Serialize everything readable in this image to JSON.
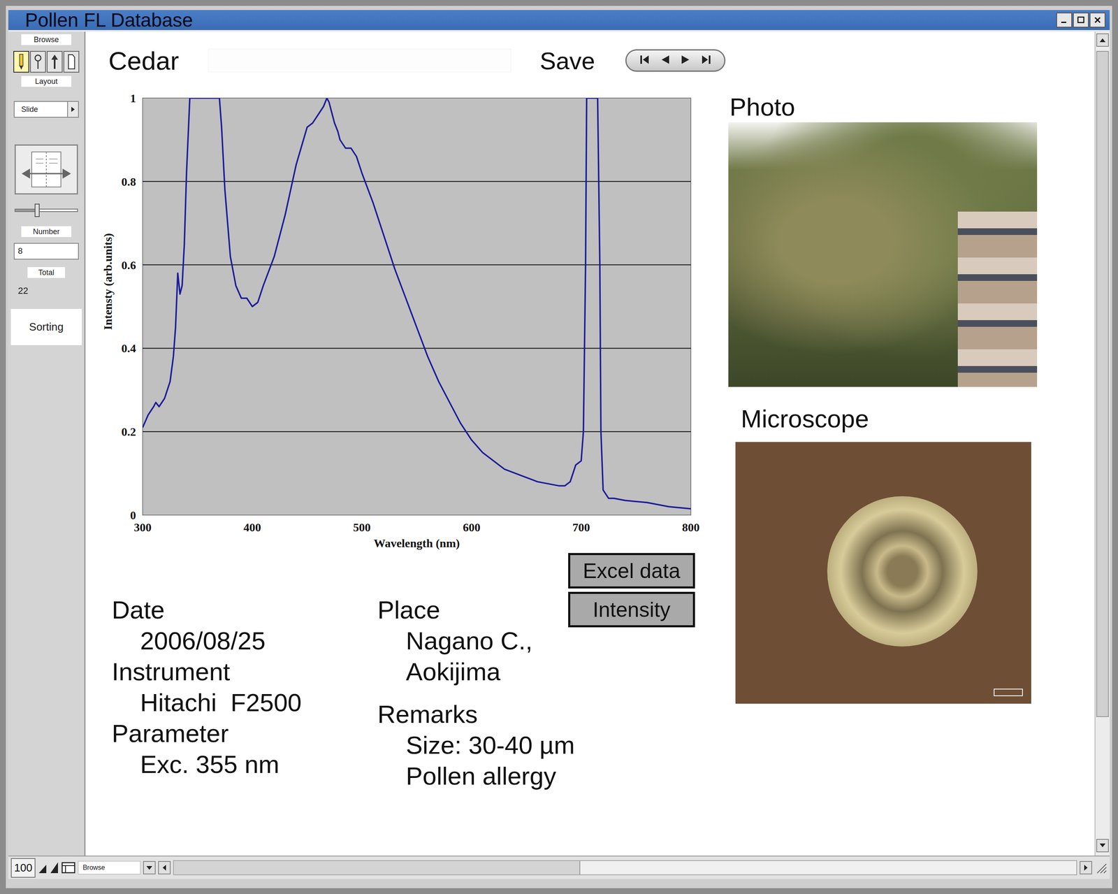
{
  "window": {
    "title": "Pollen FL Database"
  },
  "toolbar": {
    "mode_label": "Browse",
    "tools": [
      {
        "selected": true
      },
      {
        "selected": false
      },
      {
        "selected": false
      },
      {
        "selected": false
      }
    ],
    "layout_label": "Layout",
    "layout_value": "Slide",
    "slider": {
      "level": 0.35
    },
    "record_label": "Number",
    "record_value": "8",
    "total_label": "Total",
    "total_value": "22",
    "sorting": "Sorting"
  },
  "record": {
    "title": "Cedar",
    "save": "Save"
  },
  "chart": {
    "y_title": "Intensty (arb.units)",
    "x_title": "Wavelength (nm)",
    "x_ticks": [
      "300",
      "400",
      "500",
      "600",
      "700",
      "800"
    ],
    "y_ticks": [
      "0",
      "0.2",
      "0.4",
      "0.6",
      "0.8",
      "1"
    ],
    "series": [
      {
        "x": [
          300,
          305,
          310,
          312,
          315,
          320,
          325,
          328,
          330,
          332,
          334,
          336,
          338,
          340,
          343,
          346,
          350,
          360,
          368,
          370,
          372,
          375,
          380,
          385,
          390,
          395,
          400,
          405,
          410,
          420,
          430,
          440,
          450,
          455,
          460,
          465,
          468,
          470,
          472,
          475,
          478,
          480,
          485,
          490,
          495,
          500,
          510,
          520,
          530,
          540,
          550,
          560,
          570,
          580,
          590,
          600,
          610,
          620,
          630,
          640,
          650,
          660,
          670,
          680,
          685,
          690,
          695,
          700,
          702,
          704,
          705,
          710,
          715,
          717,
          718,
          720,
          725,
          730,
          740,
          760,
          780,
          800
        ],
        "y": [
          0.21,
          0.24,
          0.26,
          0.27,
          0.26,
          0.28,
          0.32,
          0.38,
          0.45,
          0.58,
          0.53,
          0.55,
          0.65,
          0.82,
          1,
          1,
          1,
          1,
          1,
          1,
          0.93,
          0.78,
          0.62,
          0.55,
          0.52,
          0.52,
          0.5,
          0.51,
          0.55,
          0.62,
          0.72,
          0.84,
          0.93,
          0.94,
          0.96,
          0.98,
          1,
          0.99,
          0.97,
          0.94,
          0.92,
          0.9,
          0.88,
          0.88,
          0.86,
          0.82,
          0.75,
          0.67,
          0.59,
          0.52,
          0.45,
          0.38,
          0.32,
          0.27,
          0.22,
          0.18,
          0.15,
          0.13,
          0.11,
          0.1,
          0.09,
          0.08,
          0.075,
          0.07,
          0.07,
          0.08,
          0.12,
          0.13,
          0.2,
          0.6,
          1,
          1,
          1,
          0.6,
          0.2,
          0.06,
          0.04,
          0.04,
          0.035,
          0.03,
          0.02,
          0.015
        ]
      }
    ]
  },
  "photo": {
    "label": "Photo"
  },
  "microscope": {
    "label": "Microscope"
  },
  "buttons": [
    "Excel data",
    "Intensity"
  ],
  "fields": [
    [
      {
        "label": "Date",
        "lines": [
          "2006/08/25"
        ]
      },
      {
        "label": "Instrument",
        "lines": [
          "Hitachi  F2500"
        ]
      },
      {
        "label": "Parameter",
        "lines": [
          "Exc. 355 nm"
        ]
      }
    ],
    [
      {
        "label": "Place",
        "lines": [
          "Nagano C.,",
          "Aokijima"
        ]
      },
      {
        "label": "Remarks",
        "lines": [
          "Size: 30-40 µm",
          "Pollen allergy"
        ]
      }
    ]
  ],
  "scrollbars": {
    "vertical": {
      "level": 0.85
    },
    "horizontal": {
      "level": 0.45
    }
  },
  "status_bar": {
    "zoom": "100",
    "mode": "Browse"
  }
}
